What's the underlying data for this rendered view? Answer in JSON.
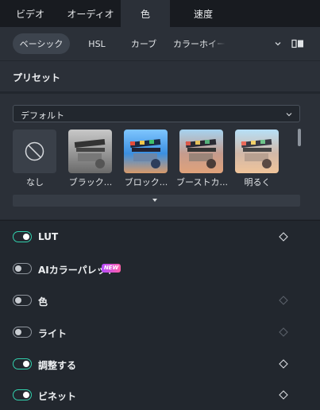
{
  "top_tabs": [
    {
      "label": "ビデオ"
    },
    {
      "label": "オーディオ"
    },
    {
      "label": "色"
    },
    {
      "label": "速度"
    }
  ],
  "sub_tabs": [
    {
      "label": "ベーシック"
    },
    {
      "label": "HSL"
    },
    {
      "label": "カーブ"
    },
    {
      "label": "カラーホイール"
    }
  ],
  "preset": {
    "title": "プリセット",
    "dropdown_value": "デフォルト",
    "items": [
      {
        "label": "なし"
      },
      {
        "label": "ブラック..."
      },
      {
        "label": "ブロック..."
      },
      {
        "label": "ブーストカ..."
      },
      {
        "label": "明るく"
      }
    ]
  },
  "adjustments": [
    {
      "label": "LUT",
      "enabled": true
    },
    {
      "label": "AIカラーパレット",
      "enabled": false,
      "badge": "NEW"
    },
    {
      "label": "色",
      "enabled": false
    },
    {
      "label": "ライト",
      "enabled": false
    },
    {
      "label": "調整する",
      "enabled": true
    },
    {
      "label": "ビネット",
      "enabled": true
    }
  ],
  "colors": {
    "accent_toggle": "#32d0ad",
    "panel_bg": "#2b3038",
    "page_bg": "#22272e"
  }
}
